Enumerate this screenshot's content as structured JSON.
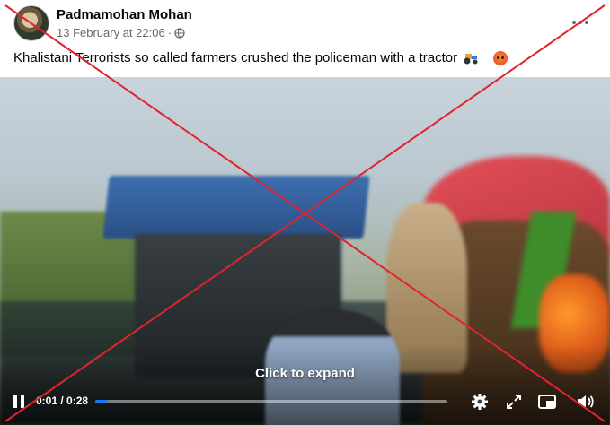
{
  "post": {
    "author": "Padmamohan Mohan",
    "date": "13 February at 22:06",
    "separator": "·",
    "privacy_icon": "globe-icon",
    "more_icon": "more-options-icon",
    "caption": "Khalistani Terrorists  so called farmers crushed the policeman with a tractor",
    "caption_emojis": [
      "tractor-emoji",
      "angry-face-emoji"
    ]
  },
  "video": {
    "overlay_text": "Click to expand",
    "current_time": "0:01",
    "duration": "0:28",
    "time_display": "0:01 / 0:28",
    "progress_fraction": 0.036,
    "progress_color": "#1877f2",
    "controls": [
      "pause-icon",
      "gear-icon",
      "expand-icon",
      "picture-in-picture-icon",
      "volume-icon"
    ]
  },
  "overlay": {
    "mark": "red-cross",
    "color": "#e0242c"
  }
}
